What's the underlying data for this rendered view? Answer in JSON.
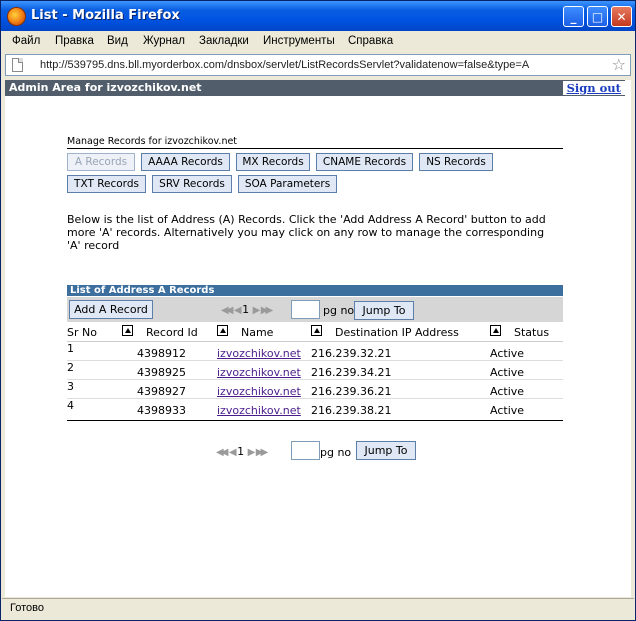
{
  "window": {
    "title": "List - Mozilla Firefox"
  },
  "menu": [
    "Файл",
    "Правка",
    "Вид",
    "Журнал",
    "Закладки",
    "Инструменты",
    "Справка"
  ],
  "address_bar": {
    "url": "http://539795.dns.bll.myorderbox.com/dnsbox/servlet/ListRecordsServlet?validatenow=false&type=A"
  },
  "admin_bar": {
    "text": "Admin Area for izvozchikov.net",
    "signout": "Sign out"
  },
  "manage": {
    "title": "Manage Records for izvozchikov.net",
    "tabs_row1": [
      "A Records",
      "AAAA Records",
      "MX Records",
      "CNAME Records",
      "NS Records"
    ],
    "tabs_row2": [
      "TXT Records",
      "SRV Records",
      "SOA Parameters"
    ],
    "active_tab": "A Records"
  },
  "description": "Below is the list of Address (A) Records. Click the 'Add Address A Record' button to add more 'A' records. Alternatively you may click on any row to manage the corresponding 'A' record",
  "list": {
    "header": "List of Address A Records",
    "add_button": "Add A Record",
    "page_number": "1",
    "pg_no_label": "pg no",
    "jump_button": "Jump To",
    "columns": [
      "Sr No",
      "Record Id",
      "Name",
      "Destination IP Address",
      "Status"
    ],
    "rows": [
      {
        "sr": "1",
        "record_id": "4398912",
        "name": "izvozchikov.net",
        "ip": "216.239.32.21",
        "status": "Active"
      },
      {
        "sr": "2",
        "record_id": "4398925",
        "name": "izvozchikov.net",
        "ip": "216.239.34.21",
        "status": "Active"
      },
      {
        "sr": "3",
        "record_id": "4398927",
        "name": "izvozchikov.net",
        "ip": "216.239.36.21",
        "status": "Active"
      },
      {
        "sr": "4",
        "record_id": "4398933",
        "name": "izvozchikov.net",
        "ip": "216.239.38.21",
        "status": "Active"
      }
    ]
  },
  "statusbar": {
    "text": "Готово"
  }
}
